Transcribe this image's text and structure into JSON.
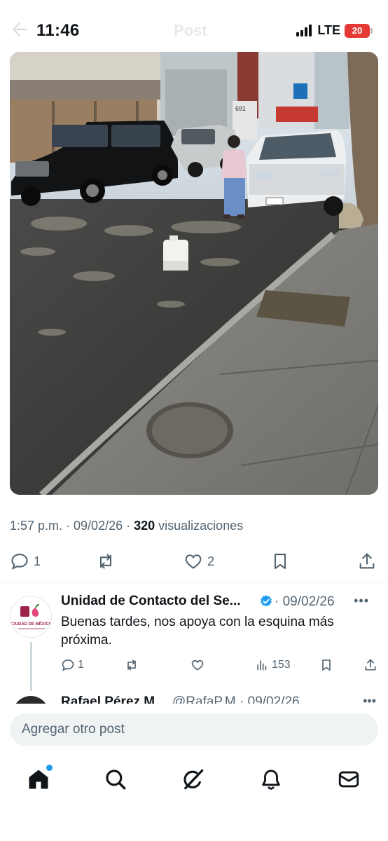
{
  "status_bar": {
    "time": "11:46",
    "network": "LTE",
    "battery": "20"
  },
  "header": {
    "title": "Post",
    "back_icon": "arrow-left-icon"
  },
  "post": {
    "image_icon": "street-photo",
    "timestamp": "1:57 p.m. · 09/02/26 · ",
    "views_count": "320",
    "views_label": " visualizaciones",
    "reply_count": "1",
    "repost_count": "",
    "like_count": "2"
  },
  "reply": {
    "author_name": "Unidad de Contacto del Se...",
    "date": "· 09/02/26",
    "more": "•••",
    "text": "Buenas tardes, nos apoya con la esquina más próxima.",
    "avatar_caption": "CIUDAD DE MÉXICO",
    "reply_count": "1",
    "views_count": "153"
  },
  "next_reply": {
    "author_name": "Rafael Pérez M...",
    "handle": "@RafaP.M · 09/02/26",
    "more": "•••"
  },
  "composer": {
    "placeholder": "Agregar otro post"
  },
  "nav": {
    "items": [
      "home-icon",
      "search-icon",
      "grok-icon",
      "notifications-icon",
      "messages-icon"
    ]
  },
  "colors": {
    "accent": "#1d9bf0",
    "muted_text": "#536471",
    "battery": "#e53935"
  }
}
